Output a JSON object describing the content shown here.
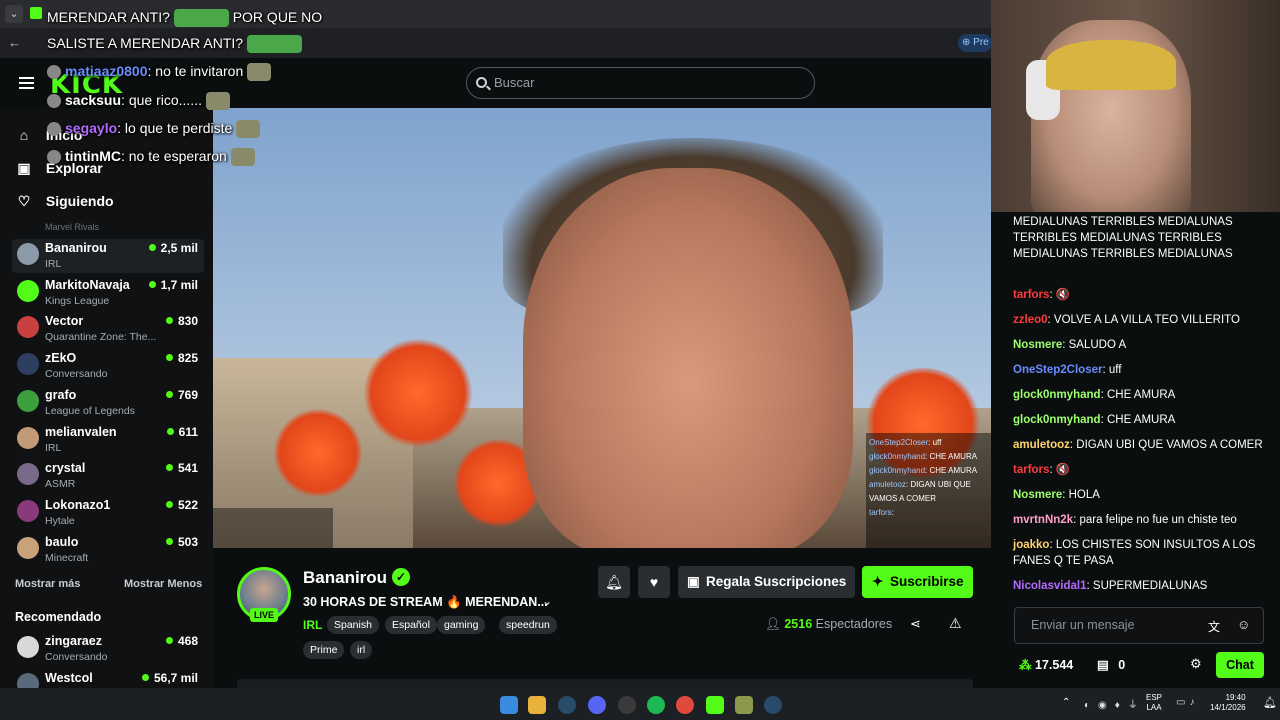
{
  "browser": {
    "promo_label": "Pre"
  },
  "header": {
    "logo": "KICK",
    "search_placeholder": "Buscar"
  },
  "overlay_top": {
    "line1": "MERENDAR ANTI?",
    "line1b": "POR QUE NO",
    "line2": "SALISTE A MERENDAR ANTI?"
  },
  "overlay_chat": [
    {
      "user": "matiaaz0800",
      "text": ": no te invitaron",
      "color": "#6a8cff"
    },
    {
      "user": "sacksuu",
      "text": ":  que rico......",
      "color": "#ffffff"
    },
    {
      "user": "segaylo",
      "text": ": lo que te perdiste",
      "color": "#b36bff"
    },
    {
      "user": "tintinMC",
      "text": ": no te esperaron",
      "color": "#ffffff"
    }
  ],
  "sidebar": {
    "nav": [
      {
        "label": "Inicio",
        "icon": "home-icon"
      },
      {
        "label": "Explorar",
        "icon": "compass-icon"
      },
      {
        "label": "Siguiendo",
        "icon": "heart-icon"
      }
    ],
    "following_partial": "Marvel Rivals",
    "channels": [
      {
        "name": "Bananirou",
        "category": "IRL",
        "viewers": "2,5 mil",
        "avatar_color": "#8a9aa8",
        "active": true
      },
      {
        "name": "MarkitoNavaja",
        "category": "Kings League",
        "viewers": "1,7 mil",
        "avatar_color": "#53fc18"
      },
      {
        "name": "Vector",
        "category": "Quarantine Zone: The...",
        "viewers": "830",
        "avatar_color": "#c94040"
      },
      {
        "name": "zEkO",
        "category": "Conversando",
        "viewers": "825",
        "avatar_color": "#2d3e60"
      },
      {
        "name": "grafo",
        "category": "League of Legends",
        "viewers": "769",
        "avatar_color": "#3da03d"
      },
      {
        "name": "melianvalen",
        "category": "IRL",
        "viewers": "611",
        "avatar_color": "#c29a78"
      },
      {
        "name": "crystal",
        "category": "ASMR",
        "viewers": "541",
        "avatar_color": "#7a6a8a"
      },
      {
        "name": "Lokonazo1",
        "category": "Hytale",
        "viewers": "522",
        "avatar_color": "#8a3a7a"
      },
      {
        "name": "baulo",
        "category": "Minecraft",
        "viewers": "503",
        "avatar_color": "#c9a27a"
      }
    ],
    "show_more": "Mostrar más",
    "show_less": "Mostrar Menos",
    "recommended_title": "Recomendado",
    "recommended": [
      {
        "name": "zingaraez",
        "category": "Conversando",
        "viewers": "468",
        "avatar_color": "#d8d8d8"
      },
      {
        "name": "Westcol",
        "category": "",
        "viewers": "56,7 mil",
        "avatar_color": "#5a6a7a"
      }
    ]
  },
  "video_chat": [
    {
      "user": "OneStep2Closer",
      "text": ": uff"
    },
    {
      "user": "glock0nmyhand",
      "text": ": CHE AMURA"
    },
    {
      "user": "glock0nmyhand",
      "text": ": CHE AMURA"
    },
    {
      "user": "amuletooz",
      "text": ": DIGAN UBI QUE VAMOS A COMER"
    },
    {
      "user": "tarfors",
      "text": ":"
    }
  ],
  "stream": {
    "streamer": "Bananirou",
    "live_label": "LIVE",
    "title": "30 HORAS DE STREAM 🔥 MERENDAN...",
    "category": "IRL",
    "tags": [
      "Spanish",
      "Español",
      "gaming",
      "speedrun",
      "Prime",
      "irl"
    ],
    "gift_label": "Regala Suscripciones",
    "subscribe_label": "Suscribirse",
    "viewers": "2516",
    "viewers_label": "Espectadores"
  },
  "chat": {
    "messages": [
      {
        "user": "",
        "text": "MEDIALUNAS  TERRIBLES MEDIALUNAS  TERRIBLES MEDIALUNAS  TERRIBLES MEDIALUNAS  TERRIBLES MEDIALUNAS",
        "color": "#ffffff"
      },
      {
        "user": "tarfors",
        "text": ": 🔇",
        "color": "#ff3b3b"
      },
      {
        "user": "zzleo0",
        "text": ": VOLVE A LA VILLA TEO VILLERITO",
        "color": "#ff3b3b"
      },
      {
        "user": "Nosmere",
        "text": ": SALUDO A",
        "color": "#9eff6e"
      },
      {
        "user": "OneStep2Closer",
        "text": ":  uff",
        "color": "#6a8cff"
      },
      {
        "user": "glock0nmyhand",
        "text": ": CHE  AMURA",
        "color": "#9eff6e"
      },
      {
        "user": "glock0nmyhand",
        "text": ": CHE  AMURA",
        "color": "#9eff6e"
      },
      {
        "user": "amuletooz",
        "text": ": DIGAN UBI QUE VAMOS A COMER",
        "color": "#ffd36e"
      },
      {
        "user": "tarfors",
        "text": ": 🔇",
        "color": "#ff3b3b"
      },
      {
        "user": "Nosmere",
        "text": ": HOLA",
        "color": "#9eff6e"
      },
      {
        "user": "mvrtnNn2k",
        "text": ": para felipe no fue un chiste teo",
        "color": "#ff9ec9"
      },
      {
        "user": "joakko",
        "text": ": LOS CHISTES SON INSULTOS A LOS FANES Q TE PASA",
        "color": "#ffd36e"
      },
      {
        "user": "Nicolasvidal1",
        "text": ": SUPERMEDIALUNAS",
        "color": "#b36bff"
      }
    ],
    "input_placeholder": "Enviar un mensaje",
    "points": "17.544",
    "gift_count": "0",
    "send_label": "Chat"
  },
  "taskbar": {
    "lang_line1": "ESP",
    "lang_line2": "LAA",
    "time": "19:40",
    "date": "14/1/2026"
  },
  "colors": {
    "accent": "#53fc18",
    "bg": "#0b0e0f"
  }
}
